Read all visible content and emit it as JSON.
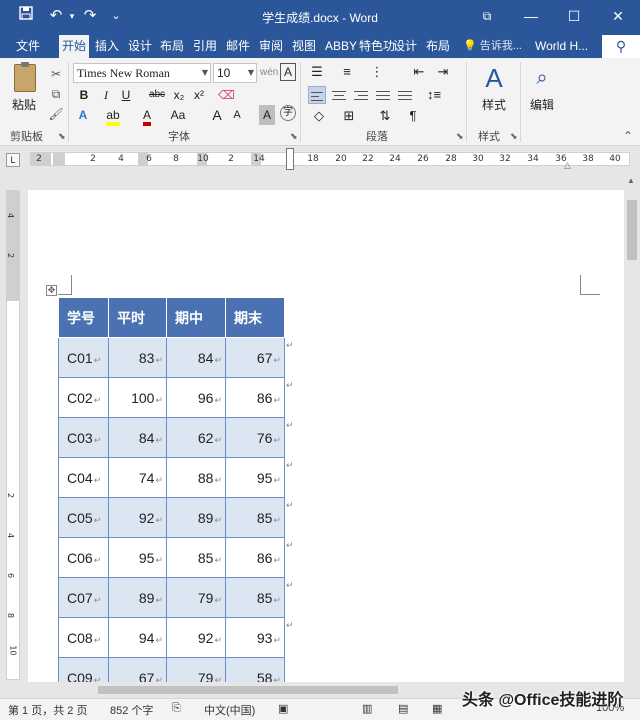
{
  "window": {
    "title": "学生成绩.docx - Word",
    "quick_access": {
      "save_icon": "save-icon",
      "undo_icon": "undo-icon",
      "redo_icon": "redo-icon",
      "customize": "⌄"
    },
    "controls": {
      "restore": "⧉",
      "minimize": "—",
      "maximize": "☐",
      "close": "✕"
    }
  },
  "tabs": {
    "file": "文件",
    "items": [
      "开始",
      "插入",
      "设计",
      "布局",
      "引用",
      "邮件",
      "审阅",
      "视图",
      "ABBY",
      "特色功",
      "设计",
      "布局"
    ],
    "active_index": 0,
    "tell_me": "告诉我...",
    "account": "World H..."
  },
  "ribbon": {
    "clipboard": {
      "paste": "粘贴",
      "label": "剪贴板"
    },
    "font": {
      "name": "Times New Roman",
      "size": "10",
      "label": "字体",
      "bold": "B",
      "italic": "I",
      "underline": "U",
      "strike": "abc",
      "subscript": "x₂",
      "superscript": "x²",
      "grow": "A",
      "shrink": "A",
      "case": "Aa",
      "clear": "A",
      "highlight_color": "#ffff00",
      "font_color": "#c00000"
    },
    "paragraph": {
      "label": "段落"
    },
    "styles": {
      "button": "样式",
      "label": "样式"
    },
    "editing": {
      "button": "编辑"
    }
  },
  "ruler": {
    "horizontal": [
      "2",
      "2",
      "4",
      "6",
      "8",
      "10",
      "2",
      "14",
      "18",
      "20",
      "22",
      "24",
      "26",
      "28",
      "30",
      "32",
      "34",
      "36",
      "38",
      "40"
    ],
    "vertical": [
      "4",
      "2",
      "2",
      "4",
      "6",
      "8",
      "10"
    ]
  },
  "table": {
    "headers": [
      "学号",
      "平时",
      "期中",
      "期末"
    ],
    "rows": [
      [
        "C01",
        "83",
        "84",
        "67"
      ],
      [
        "C02",
        "100",
        "96",
        "86"
      ],
      [
        "C03",
        "84",
        "62",
        "76"
      ],
      [
        "C04",
        "74",
        "88",
        "95"
      ],
      [
        "C05",
        "92",
        "89",
        "85"
      ],
      [
        "C06",
        "95",
        "85",
        "86"
      ],
      [
        "C07",
        "89",
        "79",
        "85"
      ],
      [
        "C08",
        "94",
        "92",
        "93"
      ],
      [
        "C09",
        "67",
        "79",
        "58"
      ]
    ],
    "mark": "↵",
    "header_color": "#4a72b3",
    "band_color": "#dce6f2"
  },
  "status": {
    "page": "第 1 页，共 2 页",
    "words": "852 个字",
    "language": "中文(中国)",
    "zoom": "100%"
  },
  "watermark": "头条 @Office技能进阶"
}
